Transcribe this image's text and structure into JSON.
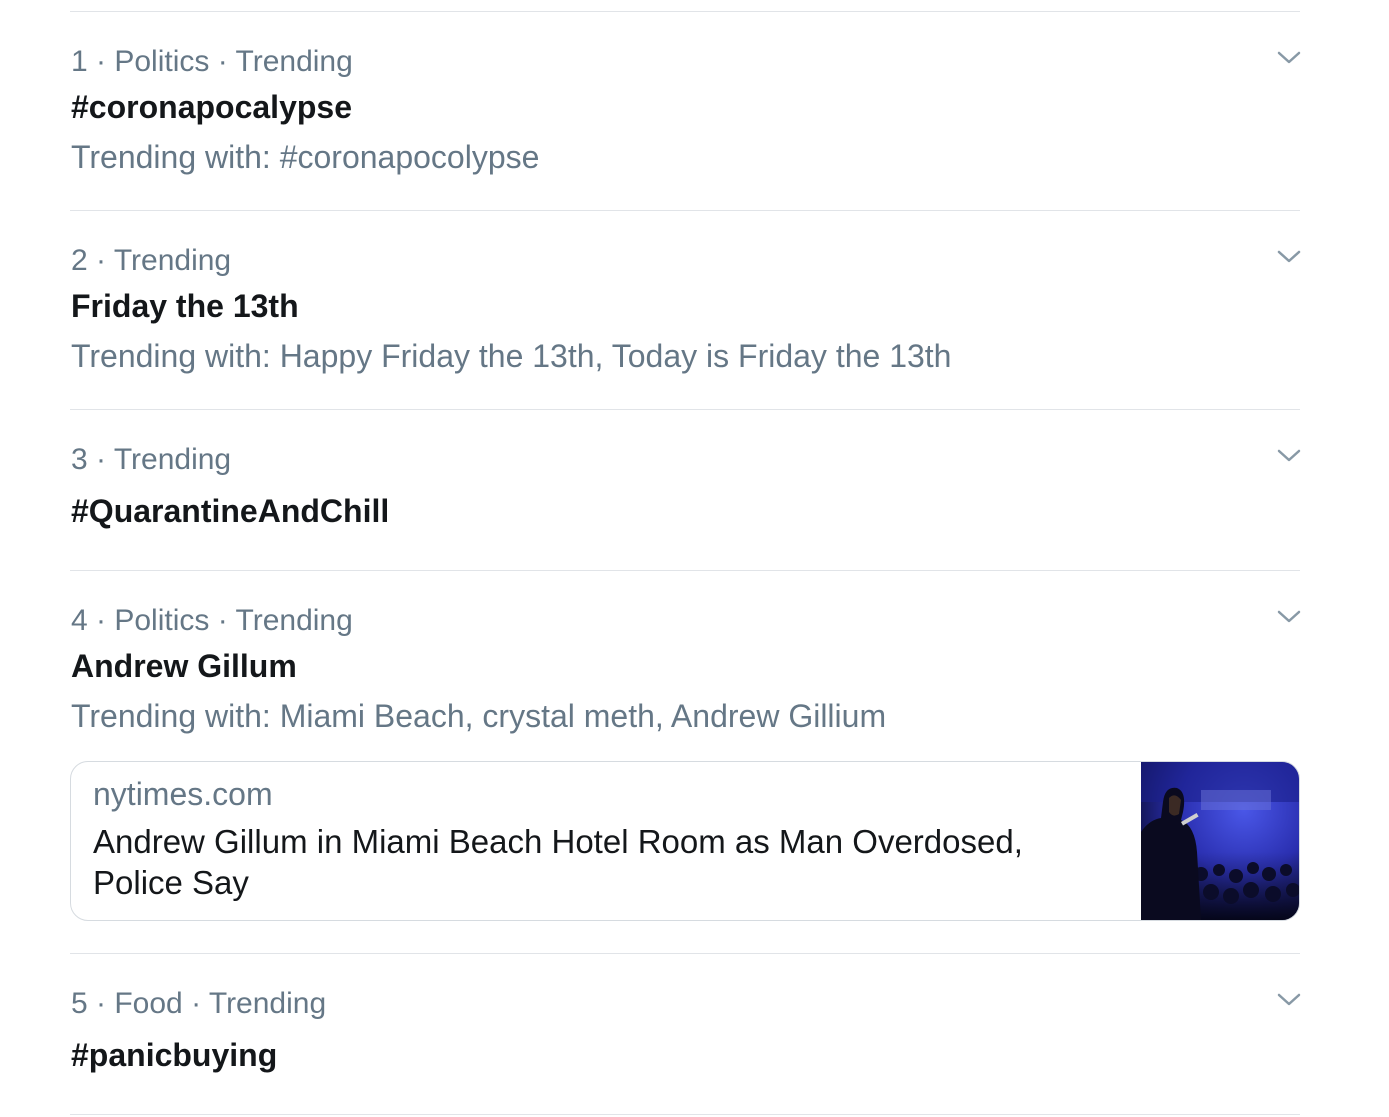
{
  "trends": [
    {
      "rank": "1",
      "meta": "· Politics · Trending",
      "title": "#coronapocalypse",
      "subtitle": "Trending with: #coronapocolypse"
    },
    {
      "rank": "2",
      "meta": "· Trending",
      "title": "Friday the 13th",
      "subtitle": "Trending with: Happy Friday the 13th, Today is Friday the 13th"
    },
    {
      "rank": "3",
      "meta": "· Trending",
      "title": "#QuarantineAndChill"
    },
    {
      "rank": "4",
      "meta": "· Politics · Trending",
      "title": "Andrew Gillum",
      "subtitle": "Trending with: Miami Beach, crystal meth, Andrew Gillium",
      "card": {
        "domain": "nytimes.com",
        "headline": "Andrew Gillum in Miami Beach Hotel Room as Man Overdosed, Police Say"
      }
    },
    {
      "rank": "5",
      "meta": "· Food · Trending",
      "title": "#panicbuying"
    }
  ],
  "icons": {
    "more": "chevron-down-icon"
  },
  "colors": {
    "text_primary": "#14171a",
    "text_secondary": "#657786",
    "divider": "#e1e4e8"
  }
}
